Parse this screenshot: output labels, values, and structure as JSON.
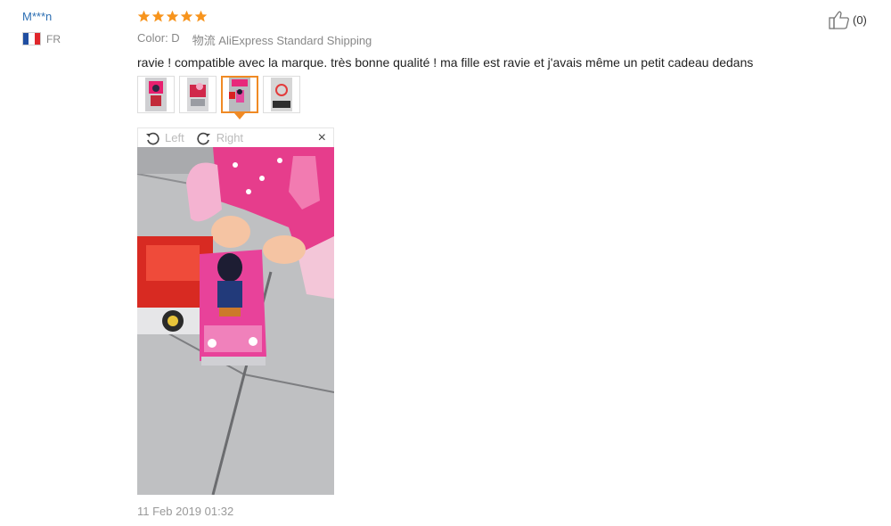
{
  "reviewer": {
    "name": "M***n",
    "country": "FR",
    "flag_colors": [
      "#1f4ea1",
      "#ffffff",
      "#e0262b"
    ]
  },
  "review": {
    "rating": 5,
    "star_color": "#f7941d",
    "color_label": "Color: D",
    "shipping_label": "物流 AliExpress Standard Shipping",
    "text": "ravie ! compatible avec la marque. très bonne qualité ! ma fille est ravie et j'avais même un petit cadeau dedans",
    "date": "11 Feb 2019 01:32"
  },
  "photos": {
    "count": 4,
    "active_index": 2,
    "thumb_colors": [
      "#e8206f",
      "#d0284a",
      "#7a7f8a",
      "#e33b3b"
    ]
  },
  "viewer": {
    "rotate_left": "Left",
    "rotate_right": "Right",
    "close": "×"
  },
  "helpful": {
    "count": "(0)"
  },
  "accent_color": "#f08a24"
}
